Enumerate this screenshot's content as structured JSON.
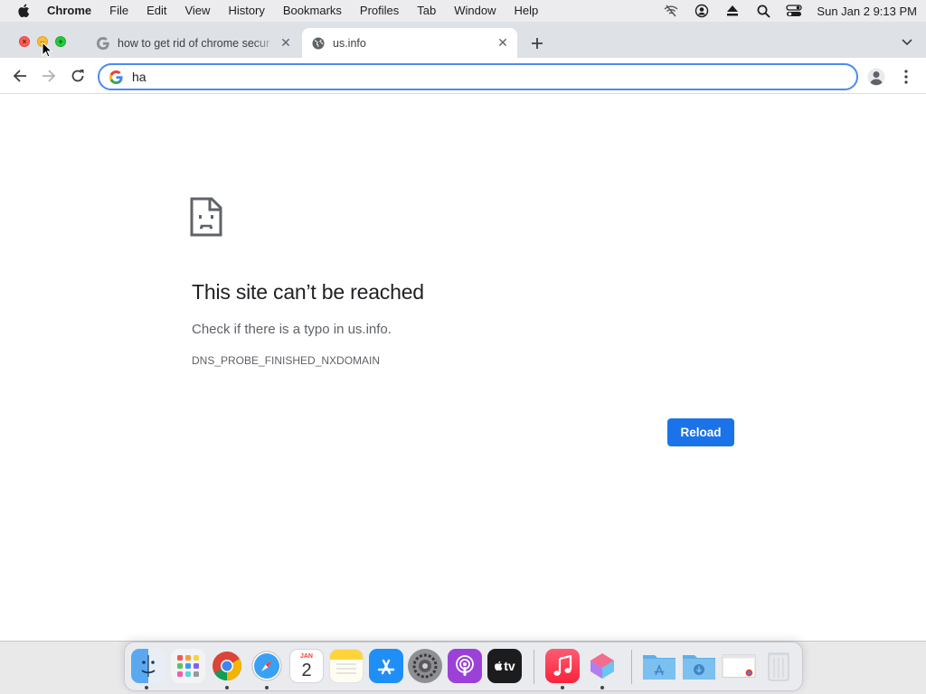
{
  "menubar": {
    "app_name": "Chrome",
    "items": [
      "File",
      "Edit",
      "View",
      "History",
      "Bookmarks",
      "Profiles",
      "Tab",
      "Window",
      "Help"
    ],
    "clock": "Sun Jan 2  9:13 PM",
    "status_icons": [
      "wifi-off-icon",
      "user-account-icon",
      "eject-icon",
      "spotlight-search-icon",
      "control-center-icon"
    ]
  },
  "tabs": [
    {
      "title": "how to get rid of chrome secur",
      "favicon": "google-icon",
      "active": false
    },
    {
      "title": "us.info",
      "favicon": "globe-icon",
      "active": true
    }
  ],
  "toolbar": {
    "address_value": "ha"
  },
  "error_page": {
    "title": "This site can’t be reached",
    "description": "Check if there is a typo in us.info.",
    "code": "DNS_PROBE_FINISHED_NXDOMAIN",
    "reload_label": "Reload"
  },
  "dock": {
    "apps": [
      "Finder",
      "Launchpad",
      "Google Chrome",
      "Safari",
      "Calendar",
      "Notes",
      "App Store",
      "System Preferences",
      "Podcasts",
      "Apple TV",
      "Music",
      "Pixelmator",
      "Applications",
      "Downloads",
      "Chrome Window",
      "Trash"
    ],
    "calendar_month": "JAN",
    "calendar_day": "2",
    "tv_label": "tv"
  },
  "colors": {
    "accent": "#1a73e8",
    "omnibox_border": "#4a8af4",
    "tabstrip": "#dee1e6"
  }
}
